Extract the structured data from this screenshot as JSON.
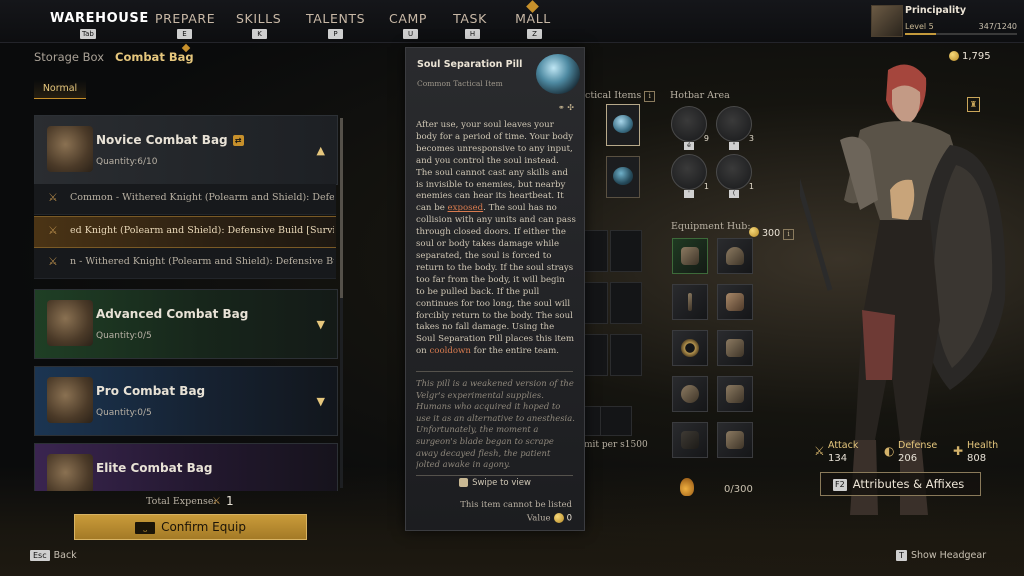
{
  "nav": {
    "items": [
      {
        "label": "WAREHOUSE",
        "key": "Tab",
        "active": true
      },
      {
        "label": "PREPARE",
        "key": "E"
      },
      {
        "label": "SKILLS",
        "key": "K"
      },
      {
        "label": "TALENTS",
        "key": "P"
      },
      {
        "label": "CAMP",
        "key": "U"
      },
      {
        "label": "TASK",
        "key": "H"
      },
      {
        "label": "MALL",
        "key": "Z"
      }
    ]
  },
  "player": {
    "name": "Principality",
    "level": "Level 5",
    "exp": "347/1240",
    "exp_fraction": 0.28
  },
  "breadcrumb": {
    "storage": "Storage Box",
    "current": "Combat Bag"
  },
  "filter_tab": "Normal",
  "bags": [
    {
      "title": "Novice Combat Bag",
      "quantity": "Quantity:6/10",
      "expanded": true,
      "color": "#2a2d31"
    },
    {
      "title": "Advanced Combat Bag",
      "quantity": "Quantity:0/5",
      "color": "#1f3f25"
    },
    {
      "title": "Pro Combat Bag",
      "quantity": "Quantity:0/5",
      "color": "#1b3552"
    },
    {
      "title": "Elite Combat Bag",
      "color": "#3a2550"
    }
  ],
  "builds": [
    "Common - Withered Knight (Polearm and Shield): Defensive Bu",
    "ed Knight (Polearm and Shield): Defensive Build [Survivability]",
    "n - Withered Knight (Polearm and Shield): Defensive Build [Bal"
  ],
  "total_expense": {
    "label": "Total Expense:",
    "value": "1"
  },
  "confirm_label": "Confirm Equip",
  "back": {
    "key": "Esc",
    "label": "Back"
  },
  "middle": {
    "tactical_label": "ctical Items",
    "limit_text": "mit per s1500"
  },
  "tooltip": {
    "name": "Soul Separation Pill",
    "subtitle": "Common Tactical Item",
    "desc_1": "After use, your soul leaves your body for a period of time. Your body becomes unresponsive to any input, and you control the soul instead. The soul cannot cast any skills and is invisible to enemies, but nearby enemies can hear its heartbeat. It can be ",
    "desc_link": "exposed",
    "desc_2": ". The soul has no collision with any units and can pass through closed doors. If either the soul or body takes damage while separated, the soul is forced to return to the body. If the soul strays too far from the body, it will begin to be pulled back. If the pull continues for too long, the soul will forcibly return to the body. The soul takes no fall damage. Using the Soul Separation Pill places this item on ",
    "desc_link2": "cooldown",
    "desc_3": " for the entire team.",
    "lore": "This pill is a weakened version of the Velgr's experimental supplies. Humans who acquired it hoped to use it as an alternative to anesthesia. Unfortunately, the moment a surgeon's blade began to scrape away decayed flesh, the patient jolted awake in agony.",
    "swipe": "Swipe to view",
    "not_listed": "This item cannot be listed",
    "value_label": "Value",
    "value": "0"
  },
  "hotbar": {
    "label": "Hotbar Area",
    "slots": [
      {
        "count": "9",
        "key": "é"
      },
      {
        "count": "3",
        "key": "\""
      },
      {
        "count": "1",
        "key": "'"
      },
      {
        "count": "1",
        "key": "("
      }
    ]
  },
  "equipment": {
    "label": "Equipment Hub:",
    "value": "300"
  },
  "capacity": "0/300",
  "gold": "1,795",
  "stats": [
    {
      "label": "Attack",
      "value": "134"
    },
    {
      "label": "Defense",
      "value": "206"
    },
    {
      "label": "Health",
      "value": "808"
    }
  ],
  "attributes_button": {
    "key": "F2",
    "label": "Attributes & Affixes"
  },
  "headgear": {
    "key": "T",
    "label": "Show Headgear"
  }
}
